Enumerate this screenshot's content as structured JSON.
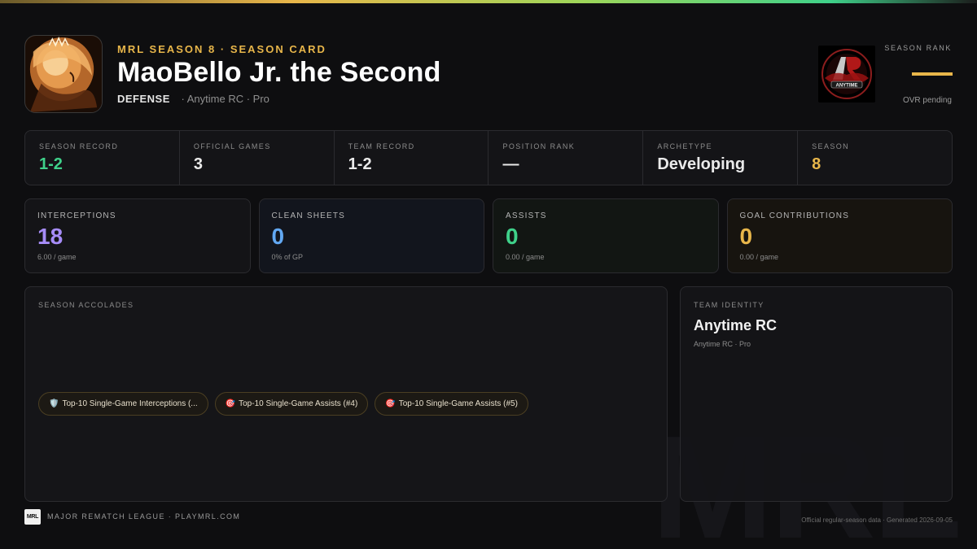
{
  "header": {
    "eyebrow": "MRL SEASON 8 · SEASON CARD",
    "player_name": "MaoBello Jr. the Second",
    "position": "DEFENSE",
    "team_tier": "· Anytime RC · Pro",
    "team_logo_icon": "anytime-rc-logo",
    "avatar_icon": "player-avatar"
  },
  "season_rank": {
    "label": "SEASON RANK",
    "sub": "OVR pending"
  },
  "stat_strip": [
    {
      "label": "SEASON RECORD",
      "value": "1-2",
      "color": "#3fd18a"
    },
    {
      "label": "OFFICIAL GAMES",
      "value": "3"
    },
    {
      "label": "TEAM RECORD",
      "value": "1-2"
    },
    {
      "label": "POSITION RANK",
      "value": "—"
    },
    {
      "label": "ARCHETYPE",
      "value": "Developing"
    },
    {
      "label": "SEASON",
      "value": "8",
      "color": "#e8b64a"
    }
  ],
  "metric_cards": [
    {
      "label": "INTERCEPTIONS",
      "value": "18",
      "sub": "6.00 / game",
      "color": "#a68cf7"
    },
    {
      "label": "CLEAN SHEETS",
      "value": "0",
      "sub": "0% of GP",
      "color": "#62a8f2"
    },
    {
      "label": "ASSISTS",
      "value": "0",
      "sub": "0.00 / game",
      "color": "#3fd18a"
    },
    {
      "label": "GOAL CONTRIBUTIONS",
      "value": "0",
      "sub": "0.00 / game",
      "color": "#e8b64a"
    }
  ],
  "accolades": {
    "label": "SEASON ACCOLADES",
    "chips": [
      {
        "icon": "🛡️",
        "icon_name": "shield-icon",
        "text": "Top-10 Single-Game Interceptions (..."
      },
      {
        "icon": "🎯",
        "icon_name": "target-icon",
        "text": "Top-10 Single-Game Assists (#4)"
      },
      {
        "icon": "🎯",
        "icon_name": "target-icon",
        "text": "Top-10 Single-Game Assists (#5)"
      }
    ]
  },
  "team_identity": {
    "label": "TEAM IDENTITY",
    "name": "Anytime RC",
    "sub": "Anytime RC · Pro"
  },
  "footer": {
    "logo": "MRL",
    "left": "MAJOR REMATCH LEAGUE · PLAYMRL.COM",
    "right": "Official regular-season data · Generated 2026-09-05",
    "watermark": "MRL"
  }
}
